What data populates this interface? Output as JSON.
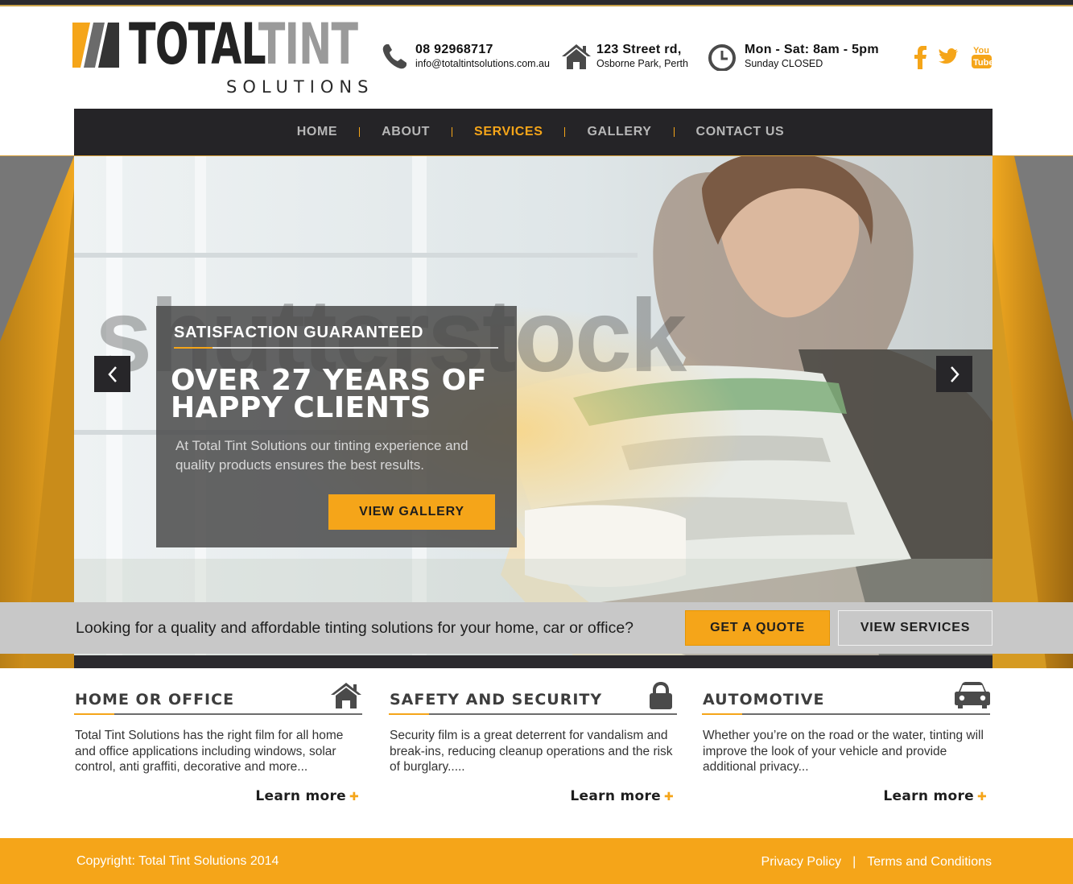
{
  "brand": {
    "name_part1": "TOTAL",
    "name_part2": "TINT",
    "subtitle": "SOLUTIONS"
  },
  "contact": {
    "phone": "08 92968717",
    "email": "info@totaltintsolutions.com.au",
    "address_line1": "123 Street rd,",
    "address_line2": "Osborne Park, Perth",
    "hours_line1": "Mon - Sat: 8am - 5pm",
    "hours_line2": "Sunday CLOSED"
  },
  "social": {
    "youtube_text_top": "You",
    "youtube_text_bottom": "Tube"
  },
  "nav": {
    "items": [
      {
        "label": "HOME",
        "active": false
      },
      {
        "label": "ABOUT",
        "active": false
      },
      {
        "label": "SERVICES",
        "active": true
      },
      {
        "label": "GALLERY",
        "active": false
      },
      {
        "label": "CONTACT US",
        "active": false
      }
    ]
  },
  "hero": {
    "watermark": "shutterstock",
    "kicker": "SATISFACTION GUARANTEED",
    "title": "OVER 27 YEARS OF HAPPY CLIENTS",
    "body": "At Total Tint Solutions our tinting experience and quality products ensures the best results.",
    "button": "VIEW GALLERY"
  },
  "cta": {
    "text": "Looking for a quality and affordable tinting solutions for your home, car or office?",
    "quote_button": "GET A QUOTE",
    "services_button": "VIEW SERVICES"
  },
  "services": [
    {
      "title": "HOME OR OFFICE",
      "icon": "home-icon",
      "body": "Total Tint Solutions has the right film for all home and office applications including windows, solar control, anti graffiti, decorative and more...",
      "more": "Learn more"
    },
    {
      "title": "SAFETY AND SECURITY",
      "icon": "lock-icon",
      "body": "Security film is a great deterrent for vandalism and break-ins, reducing cleanup operations and the risk of burglary.....",
      "more": "Learn more"
    },
    {
      "title": "AUTOMOTIVE",
      "icon": "car-icon",
      "body": "Whether you’re on the road or the water, tinting will improve the look of your vehicle and provide additional privacy...",
      "more": "Learn more"
    }
  ],
  "footer": {
    "copyright": "Copyright: Total Tint Solutions 2014",
    "privacy": "Privacy Policy",
    "separator": "|",
    "terms": "Terms and Conditions"
  },
  "colors": {
    "accent": "#f5a519",
    "dark": "#252427",
    "cta_bar": "#c8c8c8"
  }
}
